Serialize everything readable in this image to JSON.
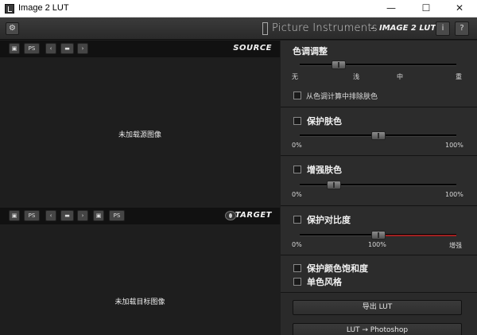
{
  "window": {
    "title": "Image 2 LUT",
    "minimize": "—",
    "maximize": "☐",
    "close": "✕"
  },
  "header": {
    "brand": "Picture Instruments",
    "separator": "-",
    "product": "IMAGE 2 LUT",
    "settings_icon": "gear-icon",
    "info_label": "i",
    "help_label": "?"
  },
  "source": {
    "label": "SOURCE",
    "ps_label": "PS",
    "empty_message": "未加载源图像"
  },
  "target": {
    "label": "TARGET",
    "ps_label": "PS",
    "ps2_label": "PS",
    "empty_message": "未加载目标图像"
  },
  "tone_adjust": {
    "title": "色调调整",
    "slider_value": 0.25,
    "ticks": [
      "无",
      "浅",
      "中",
      "重"
    ],
    "exclude_skin_label": "从色调计算中排除肤色",
    "exclude_skin_checked": false
  },
  "protect_skin": {
    "label": "保护肤色",
    "checked": false,
    "slider_value": 0.5,
    "min_label": "0%",
    "max_label": "100%"
  },
  "enhance_skin": {
    "label": "增强肤色",
    "checked": false,
    "slider_value": 0.22,
    "min_label": "0%",
    "max_label": "100%"
  },
  "protect_contrast": {
    "label": "保护对比度",
    "checked": false,
    "slider_value": 0.5,
    "min_label": "0%",
    "mid_label": "100%",
    "max_label": "增强",
    "accent_color": "#a02020"
  },
  "protect_saturation": {
    "label": "保护颜色饱和度",
    "checked": false
  },
  "monochrome": {
    "label": "单色风格",
    "checked": false
  },
  "actions": {
    "export_lut": "导出 LUT",
    "lut_photoshop": "LUT → Photoshop"
  }
}
